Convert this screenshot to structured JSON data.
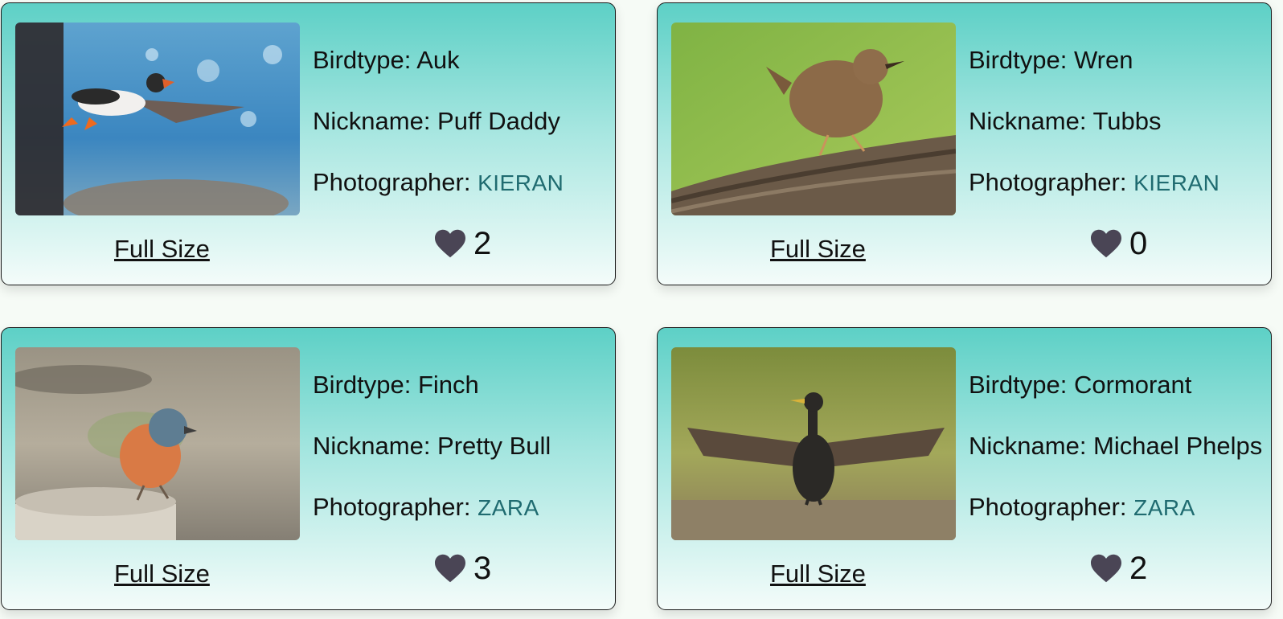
{
  "colors": {
    "heart": "#4a4555",
    "photographer": "#1f6b70",
    "card_top": "#5dd0c6",
    "card_bottom": "#f4fcfa"
  },
  "icons": {
    "like": "heart-icon"
  },
  "labels": {
    "birdtype": "Birdtype: ",
    "nickname": "Nickname: ",
    "photographer": "Photographer: ",
    "full_size": "Full Size"
  },
  "cards": [
    {
      "birdtype": "Auk",
      "nickname": "Puff Daddy",
      "photographer": "KIERAN",
      "likes": "2"
    },
    {
      "birdtype": "Wren",
      "nickname": "Tubbs",
      "photographer": "KIERAN",
      "likes": "0"
    },
    {
      "birdtype": "Finch",
      "nickname": "Pretty Bull",
      "photographer": "ZARA",
      "likes": "3"
    },
    {
      "birdtype": "Cormorant",
      "nickname": "Michael Phelps",
      "photographer": "ZARA",
      "likes": "2"
    }
  ]
}
